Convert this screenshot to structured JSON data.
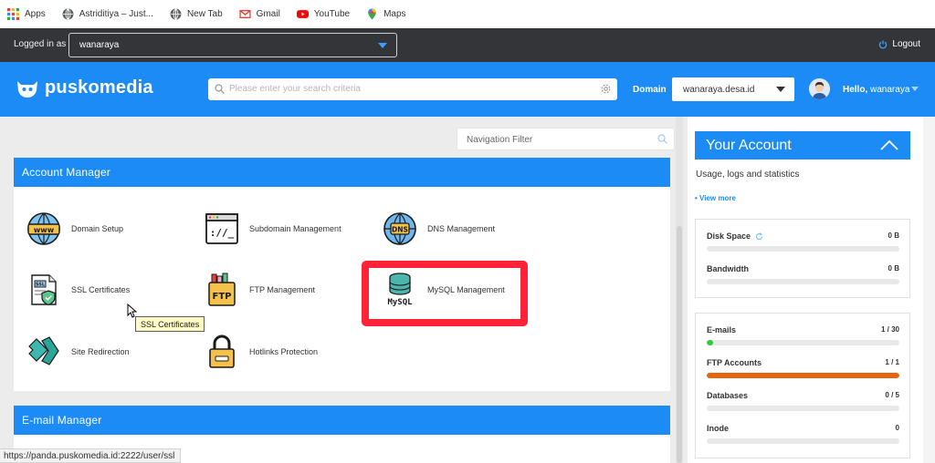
{
  "bookmarks": [
    {
      "icon": "apps-grid-icon",
      "label": "Apps"
    },
    {
      "icon": "globe-icon",
      "label": "Astriditiya – Just..."
    },
    {
      "icon": "globe-icon",
      "label": "New Tab"
    },
    {
      "icon": "gmail-icon",
      "label": "Gmail"
    },
    {
      "icon": "youtube-icon",
      "label": "YouTube"
    },
    {
      "icon": "maps-pin-icon",
      "label": "Maps"
    }
  ],
  "login": {
    "label": "Logged in as",
    "user": "wanaraya",
    "logout": "Logout"
  },
  "header": {
    "logo": "puskomedia",
    "search_placeholder": "Please enter your search criteria",
    "domain_label": "Domain",
    "domain_value": "wanaraya.desa.id",
    "hello": "Hello,",
    "hello_user": "wanaraya"
  },
  "nav_filter_placeholder": "Navigation Filter",
  "account_manager": {
    "title": "Account Manager",
    "items": [
      {
        "label": "Domain Setup",
        "icon": "www-globe-icon"
      },
      {
        "label": "Subdomain Management",
        "icon": "subdomain-browser-icon"
      },
      {
        "label": "DNS Management",
        "icon": "dns-globe-icon"
      },
      {
        "label": "SSL Certificates",
        "icon": "ssl-certificate-icon"
      },
      {
        "label": "FTP Management",
        "icon": "ftp-folder-icon"
      },
      {
        "label": "MySQL Management",
        "icon": "mysql-database-icon"
      },
      {
        "label": "Site Redirection",
        "icon": "redirect-arrows-icon"
      },
      {
        "label": "Hotlinks Protection",
        "icon": "padlock-icon"
      }
    ]
  },
  "tooltip": "SSL Certificates",
  "email_manager": {
    "title": "E-mail Manager"
  },
  "your_account": {
    "title": "Your Account",
    "subtitle": "Usage, logs and statistics",
    "view_more": "• View more",
    "stats_group1": [
      {
        "name": "Disk Space",
        "value": "0 B",
        "fill": 0,
        "color": "#1c8bf5"
      },
      {
        "name": "Bandwidth",
        "value": "0 B",
        "fill": 0,
        "color": "#1c8bf5"
      }
    ],
    "stats_group2": [
      {
        "name": "E-mails",
        "value": "1 / 30",
        "fill": 0.033,
        "color": "#2ecc40"
      },
      {
        "name": "FTP Accounts",
        "value": "1 / 1",
        "fill": 1,
        "color": "#e8650f"
      },
      {
        "name": "Databases",
        "value": "0 / 5",
        "fill": 0,
        "color": "#1c8bf5"
      },
      {
        "name": "Inode",
        "value": "0",
        "fill": 0,
        "color": "#1c8bf5"
      }
    ]
  },
  "status_url": "https://panda.puskomedia.id:2222/user/ssl",
  "colors": {
    "brand_blue": "#1c8bf5",
    "highlight_red": "#ff2337",
    "dark_bar": "#333538"
  }
}
